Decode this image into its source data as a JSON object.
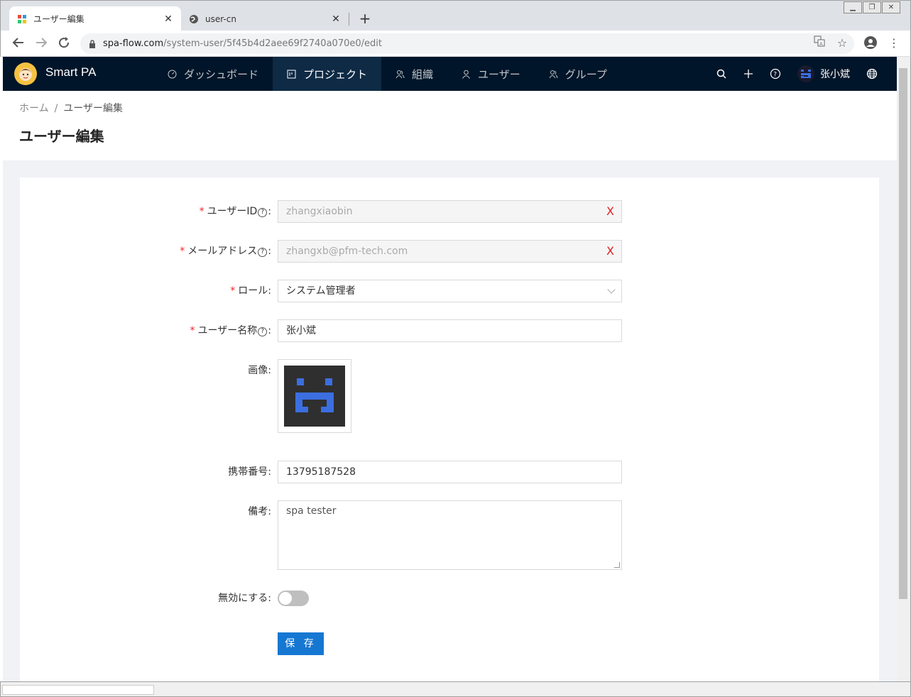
{
  "browser": {
    "tabs": [
      {
        "title": "ユーザー編集",
        "active": true
      },
      {
        "title": "user-cn",
        "active": false
      }
    ],
    "close_symbol": "✕",
    "new_tab_symbol": "+",
    "url_host": "spa-flow.com",
    "url_path": "/system-user/5f45b4d2aee69f2740a070e0/edit"
  },
  "app": {
    "brand": "Smart PA",
    "menu": [
      {
        "label": "ダッシュボード",
        "icon": "dashboard-icon"
      },
      {
        "label": "プロジェクト",
        "icon": "project-icon",
        "active": true
      },
      {
        "label": "組織",
        "icon": "team-icon"
      },
      {
        "label": "ユーザー",
        "icon": "user-icon"
      },
      {
        "label": "グループ",
        "icon": "team-icon"
      }
    ],
    "username": "张小斌"
  },
  "breadcrumb": {
    "home": "ホーム",
    "separator": "/",
    "current": "ユーザー編集"
  },
  "page_title": "ユーザー編集",
  "form": {
    "user_id": {
      "label": "ユーザーID",
      "value": "zhangxiaobin"
    },
    "email": {
      "label": "メールアドレス",
      "value": "zhangxb@pfm-tech.com"
    },
    "role": {
      "label": "ロール",
      "value": "システム管理者"
    },
    "user_name": {
      "label": "ユーザー名称",
      "value": "张小斌"
    },
    "image": {
      "label": "画像"
    },
    "phone": {
      "label": "携帯番号",
      "value": "13795187528"
    },
    "note": {
      "label": "備考",
      "value": "spa tester"
    },
    "disable": {
      "label": "無効にする",
      "value": false
    },
    "save_label": "保 存",
    "colon": ":",
    "required_mark": "*",
    "help_mark": "?",
    "clear_mark": "X"
  },
  "colors": {
    "header_bg": "#001529",
    "primary": "#1677d2",
    "required": "#f5222d",
    "avatar_blue": "#3b6ee0"
  }
}
